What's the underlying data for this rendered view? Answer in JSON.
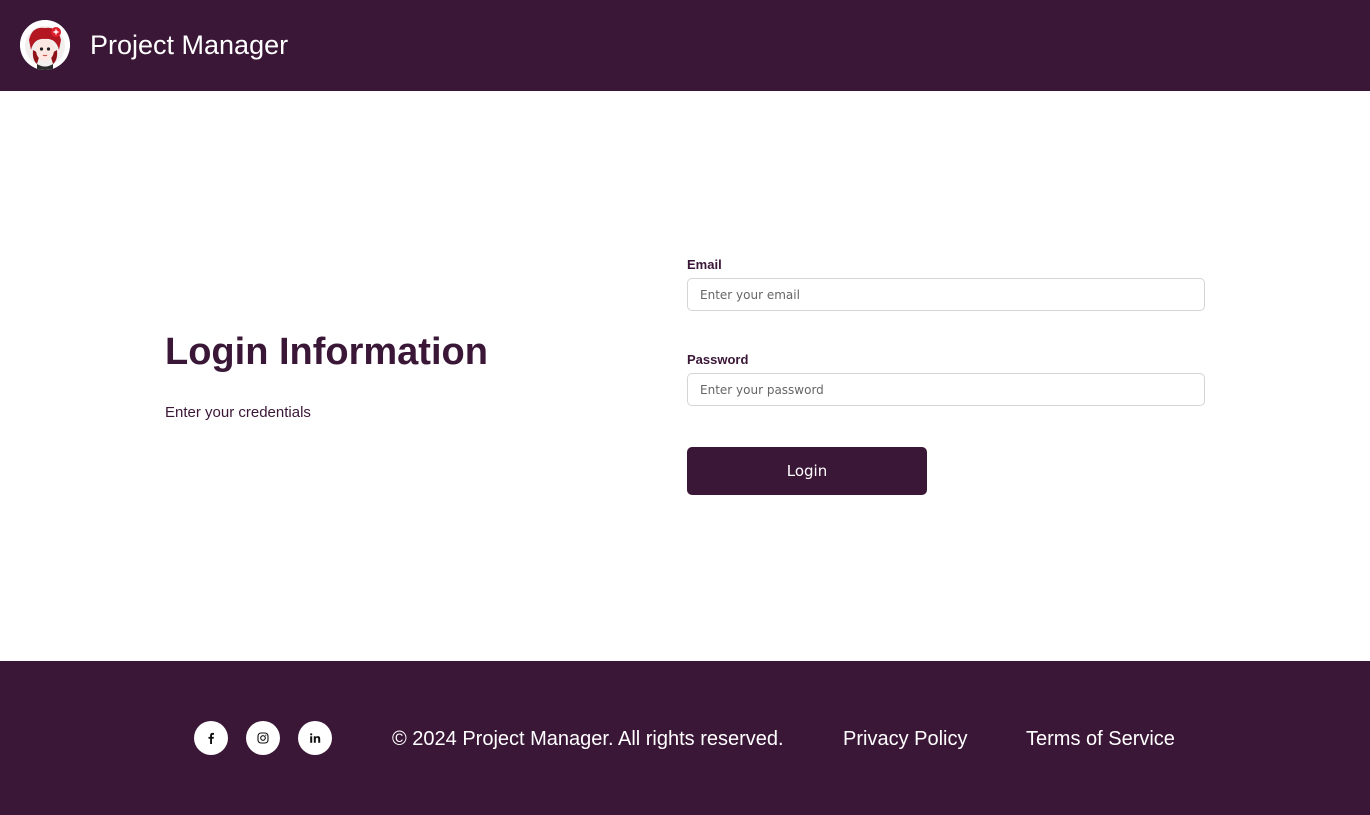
{
  "header": {
    "logo_icon": "avatar-logo-icon",
    "title": "Project Manager"
  },
  "login": {
    "heading": "Login Information",
    "subheading": "Enter your credentials",
    "email": {
      "label": "Email",
      "placeholder": "Enter your email",
      "value": ""
    },
    "password": {
      "label": "Password",
      "placeholder": "Enter your password",
      "value": ""
    },
    "submit_label": "Login"
  },
  "footer": {
    "social": [
      {
        "name": "facebook",
        "icon": "facebook-icon"
      },
      {
        "name": "instagram",
        "icon": "instagram-icon"
      },
      {
        "name": "linkedin",
        "icon": "linkedin-icon"
      }
    ],
    "copyright": "© 2024 Project Manager. All rights reserved.",
    "links": {
      "privacy": "Privacy Policy",
      "terms": "Terms of Service"
    }
  },
  "colors": {
    "brand": "#3a1637",
    "background": "#ffffff",
    "text_on_brand": "#ffffff"
  }
}
